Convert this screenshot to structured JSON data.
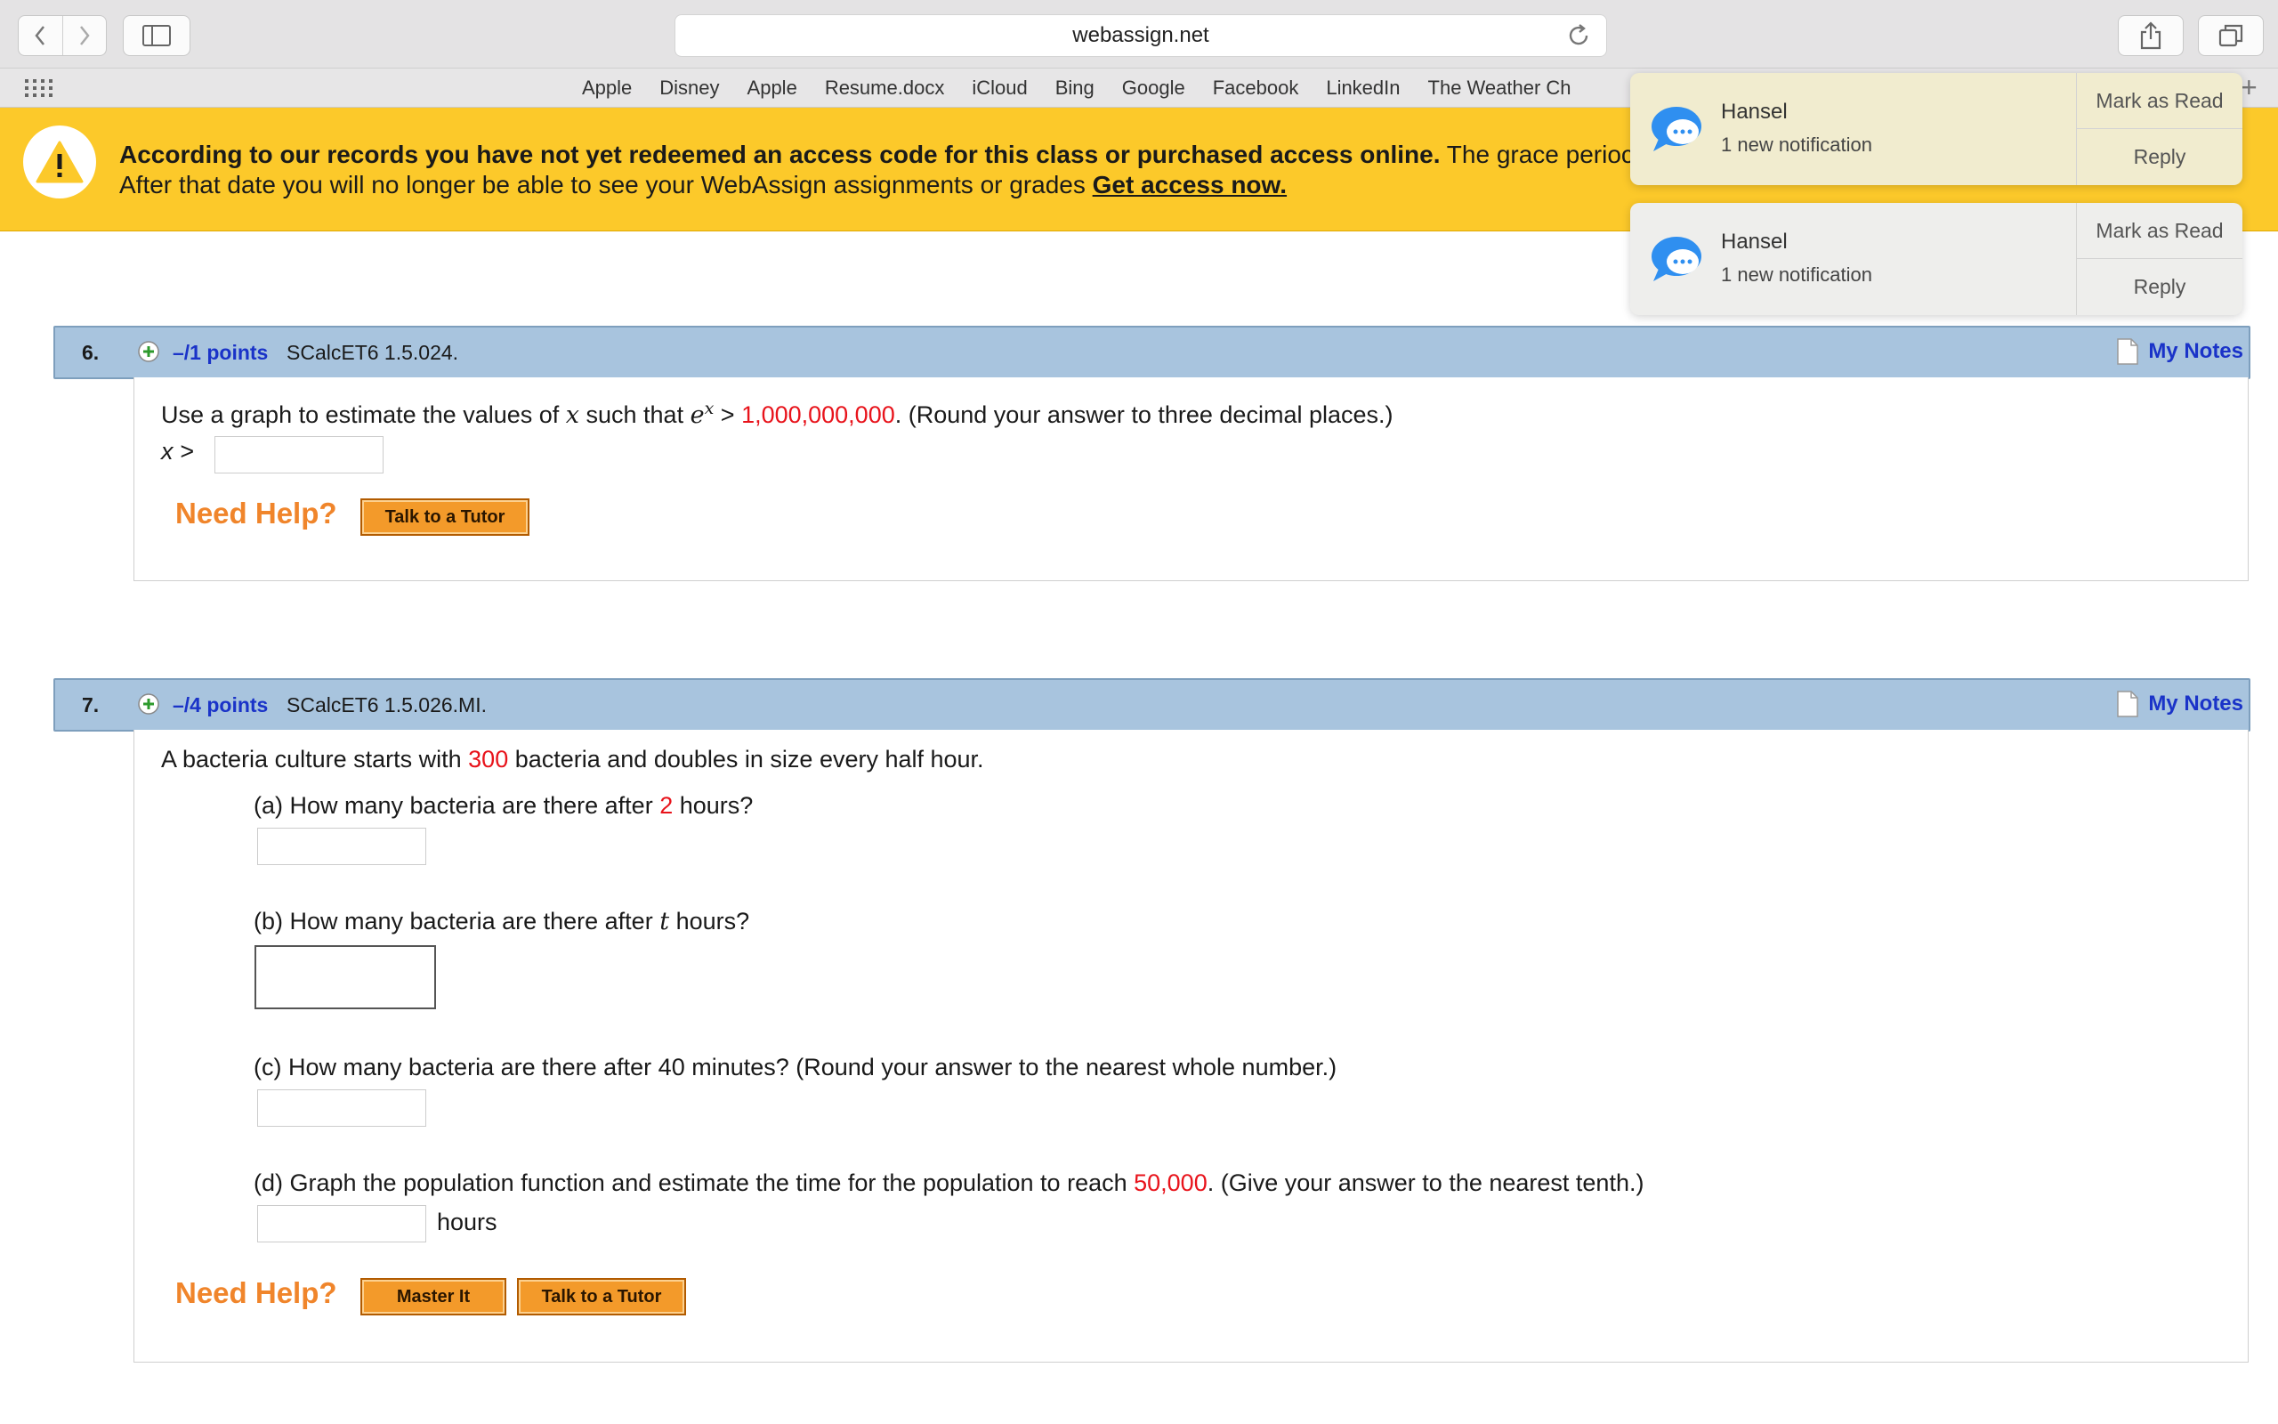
{
  "browser": {
    "url": "webassign.net",
    "favorites": [
      "Apple",
      "Disney",
      "Apple",
      "Resume.docx",
      "iCloud",
      "Bing",
      "Google",
      "Facebook",
      "LinkedIn",
      "The Weather Ch"
    ]
  },
  "banner": {
    "bold_text": "According to our records you have not yet redeemed an access code for this class or purchased access online.",
    "grace_text": " The grace perioc",
    "line2": "After that date you will no longer be able to see your WebAssign assignments or grades ",
    "link": "Get access now."
  },
  "notifications": [
    {
      "sender": "Hansel",
      "message": "1 new notification",
      "action1": "Mark as Read",
      "action2": "Reply"
    },
    {
      "sender": "Hansel",
      "message": "1 new notification",
      "action1": "Mark as Read",
      "action2": "Reply"
    }
  ],
  "q6": {
    "number": "6.",
    "points": "–/1 points",
    "code": "SCalcET6 1.5.024.",
    "notes_label": "My Notes",
    "text_a": "Use a graph to estimate the values of ",
    "var_x": "x",
    "text_b": " such that ",
    "expr_e": "e",
    "expr_sup": "x",
    "text_c": " > ",
    "value": "1,000,000,000",
    "text_d": ". (Round your answer to three decimal places.)",
    "answer_label": "x >",
    "help_label": "Need Help?",
    "tutor_btn": "Talk to a Tutor"
  },
  "q7": {
    "number": "7.",
    "points": "–/4 points",
    "code": "SCalcET6 1.5.026.MI.",
    "notes_label": "My Notes",
    "intro_a": "A bacteria culture starts with ",
    "intro_val": "300",
    "intro_b": " bacteria and doubles in size every half hour.",
    "a_text": "(a) How many bacteria are there after ",
    "a_val": "2",
    "a_text2": " hours?",
    "b_text": "(b) How many bacteria are there after ",
    "b_var": "t",
    "b_text2": " hours?",
    "c_text": "(c) How many bacteria are there after 40 minutes? (Round your answer to the nearest whole number.)",
    "d_text": "(d) Graph the population function and estimate the time for the population to reach ",
    "d_val": "50,000",
    "d_text2": ". (Give your answer to the nearest tenth.)",
    "d_unit": "hours",
    "help_label": "Need Help?",
    "master_btn": "Master It",
    "tutor_btn": "Talk to a Tutor"
  }
}
